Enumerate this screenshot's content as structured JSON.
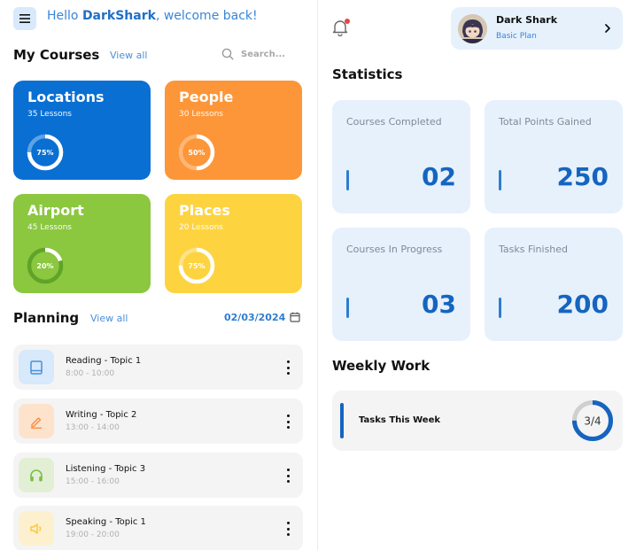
{
  "header": {
    "greeting_prefix": "Hello ",
    "user_name": "DarkShark",
    "greeting_suffix": ", welcome back!"
  },
  "courses_section": {
    "title": "My Courses",
    "view_all": "View all",
    "search_placeholder": "Search...",
    "items": [
      {
        "title": "Locations",
        "lessons": "35 Lessons",
        "progress_label": "75%",
        "progress": 0.75,
        "color": "#0a6fd3",
        "ring_track": "#5ea3e6"
      },
      {
        "title": "People",
        "lessons": "30 Lessons",
        "progress_label": "50%",
        "progress": 0.5,
        "color": "#fd9638",
        "ring_track": "#fdb778"
      },
      {
        "title": "Airport",
        "lessons": "45 Lessons",
        "progress_label": "20%",
        "progress": 0.2,
        "color": "#8bc73f",
        "ring_track": "#5fa328"
      },
      {
        "title": "Places",
        "lessons": "20 Lessons",
        "progress_label": "75%",
        "progress": 0.75,
        "color": "#fed340",
        "ring_track": "#fee38a"
      }
    ]
  },
  "planning": {
    "title": "Planning",
    "view_all": "View all",
    "date": "02/03/2024",
    "items": [
      {
        "title": "Reading - Topic 1",
        "time": "8:00 - 10:00",
        "icon": "book-icon",
        "bg": "#d7e9fb",
        "fg": "#4a90d9"
      },
      {
        "title": "Writing - Topic 2",
        "time": "13:00 - 14:00",
        "icon": "pencil-icon",
        "bg": "#fde3cc",
        "fg": "#f5934a"
      },
      {
        "title": "Listening - Topic 3",
        "time": "15:00 - 16:00",
        "icon": "headphones-icon",
        "bg": "#e2efd5",
        "fg": "#7cbf45"
      },
      {
        "title": "Speaking - Topic 1",
        "time": "19:00 - 20:00",
        "icon": "speaker-icon",
        "bg": "#fdf0cf",
        "fg": "#f8c83c"
      }
    ]
  },
  "profile": {
    "name": "Dark Shark",
    "plan": "Basic Plan"
  },
  "statistics": {
    "title": "Statistics",
    "cards": [
      {
        "label": "Courses Completed",
        "value": "02"
      },
      {
        "label": "Total Points Gained",
        "value": "250"
      },
      {
        "label": "Courses In Progress",
        "value": "03"
      },
      {
        "label": "Tasks Finished",
        "value": "200"
      }
    ]
  },
  "weekly": {
    "title": "Weekly Work",
    "label": "Tasks This Week",
    "progress_label": "3/4",
    "progress": 0.75
  }
}
